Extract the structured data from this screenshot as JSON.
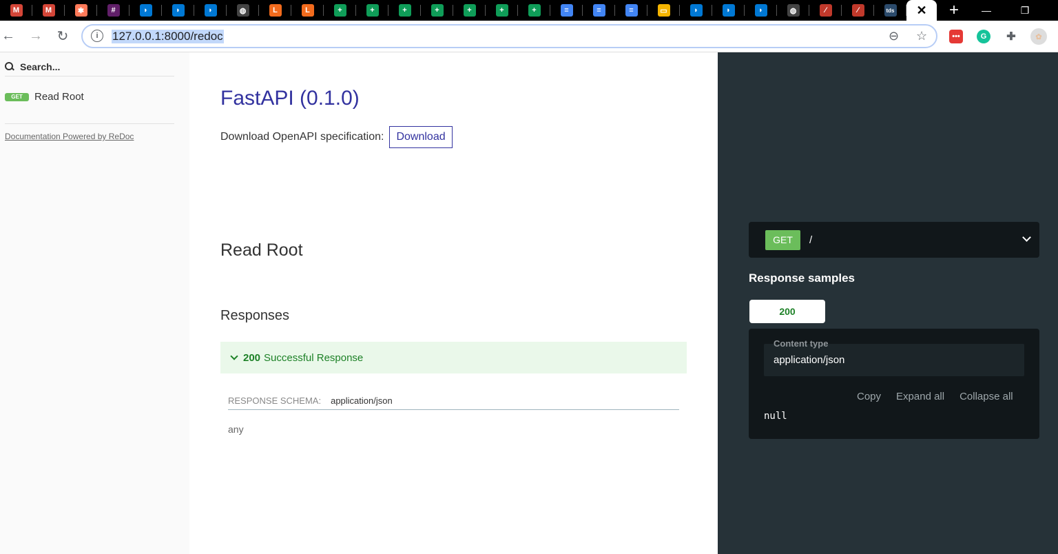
{
  "browser": {
    "tabs": [
      {
        "icon": "gmail-icon",
        "color": "#d44638",
        "glyph": "M"
      },
      {
        "icon": "gmail-icon",
        "color": "#d44638",
        "glyph": "M"
      },
      {
        "icon": "hubspot-icon",
        "color": "#ff7a59",
        "glyph": "✱"
      },
      {
        "icon": "slack-icon",
        "color": "#611f69",
        "glyph": "#"
      },
      {
        "icon": "azure-devops-icon",
        "color": "#0078d4",
        "glyph": "◗"
      },
      {
        "icon": "azure-devops-icon",
        "color": "#0078d4",
        "glyph": "◗"
      },
      {
        "icon": "azure-devops-icon",
        "color": "#0078d4",
        "glyph": "◗"
      },
      {
        "icon": "globe-icon",
        "color": "#444444",
        "glyph": "◍"
      },
      {
        "icon": "orange-app-icon",
        "color": "#f26b1d",
        "glyph": "L"
      },
      {
        "icon": "orange-app-icon",
        "color": "#f26b1d",
        "glyph": "L"
      },
      {
        "icon": "sheets-icon",
        "color": "#0f9d58",
        "glyph": "+"
      },
      {
        "icon": "sheets-icon",
        "color": "#0f9d58",
        "glyph": "+"
      },
      {
        "icon": "sheets-icon",
        "color": "#0f9d58",
        "glyph": "+"
      },
      {
        "icon": "sheets-icon",
        "color": "#0f9d58",
        "glyph": "+"
      },
      {
        "icon": "sheets-icon",
        "color": "#0f9d58",
        "glyph": "+"
      },
      {
        "icon": "sheets-icon",
        "color": "#0f9d58",
        "glyph": "+"
      },
      {
        "icon": "sheets-icon",
        "color": "#0f9d58",
        "glyph": "+"
      },
      {
        "icon": "docs-icon",
        "color": "#4285f4",
        "glyph": "≡"
      },
      {
        "icon": "docs-icon",
        "color": "#4285f4",
        "glyph": "≡"
      },
      {
        "icon": "docs-icon",
        "color": "#4285f4",
        "glyph": "≡"
      },
      {
        "icon": "slides-icon",
        "color": "#f4b400",
        "glyph": "▭"
      },
      {
        "icon": "azure-devops-icon",
        "color": "#0078d4",
        "glyph": "◗"
      },
      {
        "icon": "azure-devops-icon",
        "color": "#0078d4",
        "glyph": "◗"
      },
      {
        "icon": "azure-devops-icon",
        "color": "#0078d4",
        "glyph": "◗"
      },
      {
        "icon": "globe-icon",
        "color": "#444444",
        "glyph": "◍"
      },
      {
        "icon": "feather-icon",
        "color": "#c0392b",
        "glyph": "⁄"
      },
      {
        "icon": "feather-icon",
        "color": "#c0392b",
        "glyph": "⁄"
      },
      {
        "icon": "tds-icon",
        "color": "#2b4a6b",
        "glyph": "tds"
      }
    ],
    "active_tab_close": "✕",
    "new_tab": "+",
    "minimize": "—",
    "restore": "❐",
    "back": "←",
    "forward": "→",
    "reload": "↻",
    "info": "i",
    "url": "127.0.0.1:8000/redoc",
    "zoom": "⊖",
    "star": "☆"
  },
  "sidebar": {
    "search_placeholder": "Search...",
    "items": [
      {
        "method": "GET",
        "label": "Read Root"
      }
    ],
    "powered_by": "Documentation Powered by ReDoc"
  },
  "main": {
    "api_title": "FastAPI (0.1.0)",
    "download_label": "Download OpenAPI specification:",
    "download_button": "Download",
    "operation_title": "Read Root",
    "responses_heading": "Responses",
    "response": {
      "code": "200",
      "description": "Successful Response"
    },
    "schema_label": "RESPONSE SCHEMA:",
    "schema_content_type": "application/json",
    "schema_type": "any"
  },
  "right_panel": {
    "method": "GET",
    "path": "/",
    "samples_title": "Response samples",
    "sample_tab": "200",
    "content_type_label": "Content type",
    "content_type_value": "application/json",
    "actions": [
      "Copy",
      "Expand all",
      "Collapse all"
    ],
    "sample_body": "null"
  },
  "colors": {
    "brand": "#32329f",
    "get_badge": "#6bbd5b",
    "success_text": "#1d8127",
    "success_bg": "#eaf8ea",
    "right_panel_bg": "#263238"
  }
}
